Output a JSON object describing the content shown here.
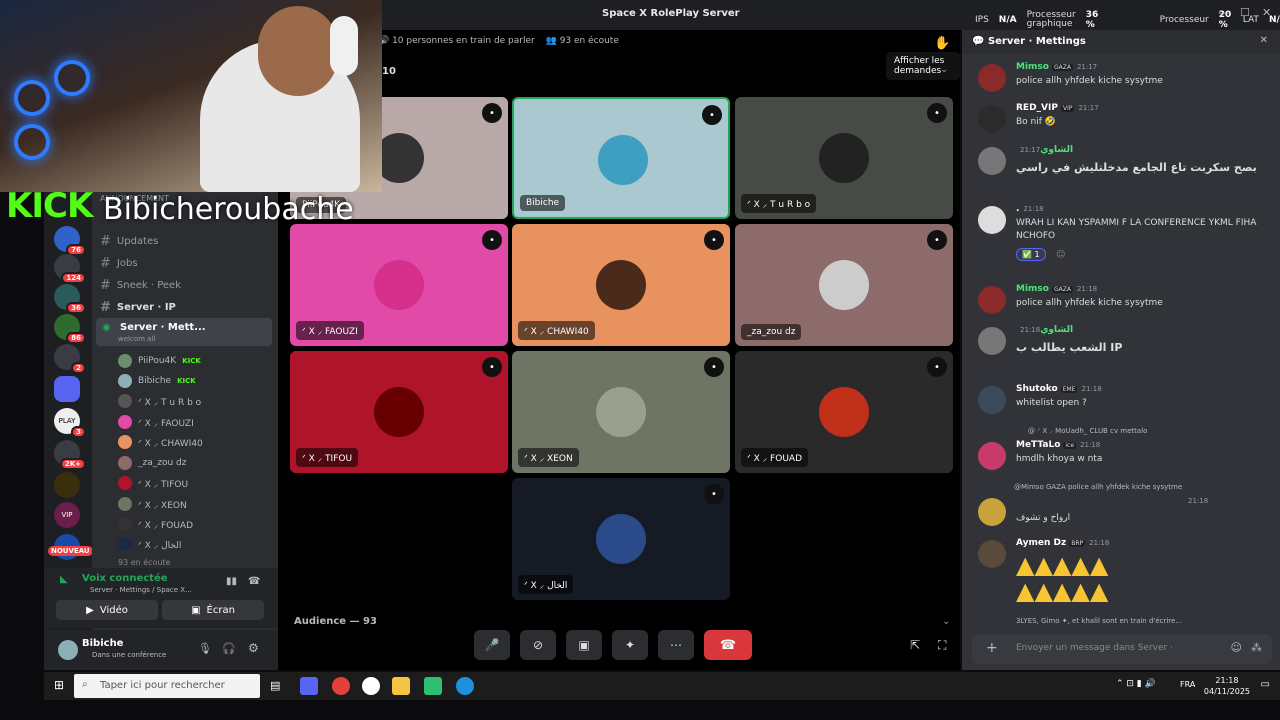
{
  "window": {
    "title": "Space X RolePlay Server",
    "ips_label": "IPS",
    "ips_value": "N/A",
    "gpu_label": "Processeur graphique",
    "gpu_value": "36 %",
    "cpu_label": "Processeur",
    "cpu_value": "20 %",
    "lat_label": "LAT",
    "lat_value": "N/A"
  },
  "overlay": {
    "kick": "KICK",
    "streamer": "Bibicheroubache"
  },
  "servers": [
    {
      "badge": "76"
    },
    {
      "badge": "124"
    },
    {
      "badge": "36"
    },
    {
      "badge": "86"
    },
    {
      "badge": "2"
    },
    {
      "badge": "3"
    },
    {
      "badge": "2K+"
    },
    {
      "badge": ""
    },
    {
      "badge": ""
    },
    {
      "badge": "NOUVEAU"
    }
  ],
  "channels": {
    "announcement": "ANNOUNCEMENT",
    "items": [
      {
        "label": "Updates"
      },
      {
        "label": "Jobs"
      },
      {
        "label": "Sneek · Peek"
      },
      {
        "label": "Server · IP"
      }
    ],
    "active": "Server · Mett...",
    "welcome": "welcom all",
    "listening_count": "93 en écoute"
  },
  "members": [
    {
      "name": "PiiPou4K",
      "tag": "KICK"
    },
    {
      "name": "Bibiche",
      "tag": "KICK"
    },
    {
      "name": "ᐟ X ⸝ T u R b o",
      "tag": ""
    },
    {
      "name": "ᐟ X ⸝ FAOUZI",
      "tag": ""
    },
    {
      "name": "ᐟ X ⸝ CHAWI40",
      "tag": ""
    },
    {
      "name": "_za_zou dz",
      "tag": ""
    },
    {
      "name": "ᐟ X ⸝ TIFOU",
      "tag": ""
    },
    {
      "name": "ᐟ X ⸝ XEON",
      "tag": ""
    },
    {
      "name": "ᐟ X ⸝ FOUAD",
      "tag": ""
    },
    {
      "name": "ᐟ X ⸝ الخال",
      "tag": ""
    }
  ],
  "voice": {
    "status": "Voix connectée",
    "location": "Server · Mettings / Space X...",
    "video": "Vidéo",
    "screen": "Écran"
  },
  "user": {
    "name": "Bibiche",
    "status": "Dans une conférence"
  },
  "stage": {
    "speaking": "10 personnes en train de parler",
    "listening": "93 en écoute",
    "count": "10",
    "tooltip": "Afficher les demandes",
    "audience": "Audience — 93"
  },
  "tiles": [
    {
      "name": "PiiPou4K",
      "color": "#b8a8a8"
    },
    {
      "name": "Bibiche",
      "color": "#a9c8cf"
    },
    {
      "name": "ᐟ X ⸝ T u R b o",
      "color": "#474b45"
    },
    {
      "name": "ᐟ X ⸝ FAOUZI",
      "color": "#e24aa8"
    },
    {
      "name": "ᐟ X ⸝ CHAWI40",
      "color": "#e8935f"
    },
    {
      "name": "_za_zou dz",
      "color": "#8e6b6b"
    },
    {
      "name": "ᐟ X ⸝ TIFOU",
      "color": "#b0142a"
    },
    {
      "name": "ᐟ X ⸝ XEON",
      "color": "#6e7565"
    },
    {
      "name": "ᐟ X ⸝ FOUAD",
      "color": "#2a2a2a"
    },
    {
      "name": "ᐟ X ⸝ الخال",
      "color": "#151a24"
    }
  ],
  "chat": {
    "header": "Server · Mettings",
    "input_placeholder": "Envoyer un message dans",
    "input_channel": "Server ·",
    "typing": "3LYES, Gimo ✦, et khalil sont en train d'écrire...",
    "messages": [
      {
        "author": "Mimso",
        "tag": "GAZA",
        "time": "21:17",
        "text": "police allh yhfdek kiche sysytme",
        "color": "#4ae37a"
      },
      {
        "author": "RED_VIP",
        "tag": "VIP",
        "time": "21:17",
        "text": "Bo nif 🤣",
        "color": "#ffffff"
      },
      {
        "author": "الشاوي",
        "tag": "",
        "time": "21:17",
        "text": "بصح سكربت تاع الجامع مدخلتليش في راسي",
        "color": "#4ae37a"
      },
      {
        "author": ".",
        "tag": "",
        "time": "21:18",
        "text": "WRAH LI KAN YSPAMMI F LA CONFERENCE YKML FIHA NCHOFO",
        "color": "#ffffff"
      },
      {
        "author": "Mimso",
        "tag": "GAZA",
        "time": "21:18",
        "text": "police allh yhfdek kiche sysytme",
        "color": "#4ae37a"
      },
      {
        "author": "الشاوي",
        "tag": "",
        "time": "21:18",
        "text": "الشعب يطالب ب IP",
        "color": "#4ae37a"
      },
      {
        "author": "Shutoko",
        "tag": "EME",
        "time": "21:18",
        "text": "whitelist open ?",
        "color": "#ffffff"
      },
      {
        "author": "MeTTaLo",
        "tag": "ice",
        "time": "21:18",
        "text": "hmdlh khoya w nta",
        "color": "#ffffff"
      },
      {
        "author": "",
        "tag": "",
        "time": "21:18",
        "text": "ارواح و تشوف",
        "color": "#ffffff"
      },
      {
        "author": "Aymen Dz",
        "tag": "BRP",
        "time": "21:18",
        "text": "",
        "color": "#ffffff"
      }
    ],
    "reply1": "@ ᐟ X ⸝ MoUadh_  CLUB cv mettalo",
    "reply2": "@Mimso  GAZA police allh yhfdek kiche sysytme",
    "reaction": "1"
  },
  "taskbar": {
    "search": "Taper ici pour rechercher",
    "lang": "FRA",
    "time": "21:18",
    "date": "04/11/2025"
  }
}
